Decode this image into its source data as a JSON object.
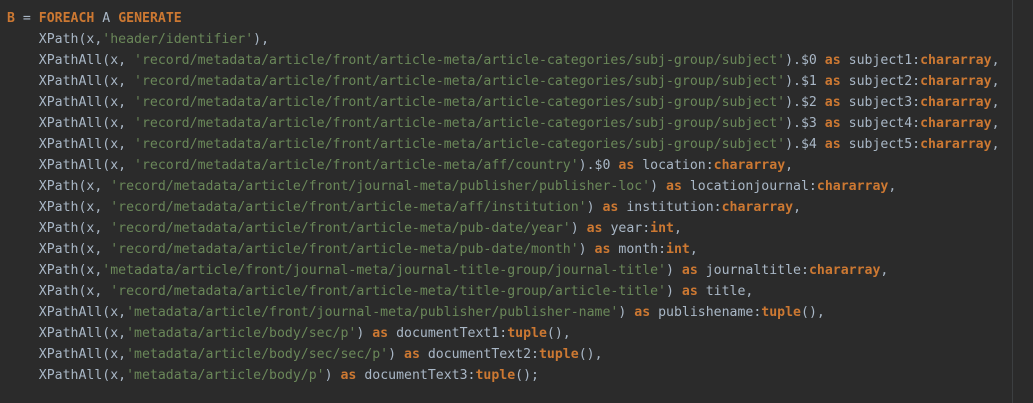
{
  "colors": {
    "background": "#2b2b2b",
    "plain": "#a9b7c6",
    "keyword": "#cc7832",
    "string": "#6a8759",
    "margin_line": "#3c3f41"
  },
  "code": {
    "lines": [
      [
        {
          "t": "kw",
          "v": "B "
        },
        {
          "t": "plain",
          "v": "= "
        },
        {
          "t": "kw",
          "v": "FOREACH"
        },
        {
          "t": "plain",
          "v": " A "
        },
        {
          "t": "kw",
          "v": "GENERATE"
        }
      ],
      [
        {
          "t": "plain",
          "v": "    XPath(x,"
        },
        {
          "t": "str",
          "v": "'header/identifier'"
        },
        {
          "t": "plain",
          "v": "),"
        }
      ],
      [
        {
          "t": "plain",
          "v": "    XPathAll(x, "
        },
        {
          "t": "str",
          "v": "'record/metadata/article/front/article-meta/article-categories/subj-group/subject'"
        },
        {
          "t": "plain",
          "v": ").$0 "
        },
        {
          "t": "kw",
          "v": "as"
        },
        {
          "t": "plain",
          "v": " subject1:"
        },
        {
          "t": "kw",
          "v": "chararray"
        },
        {
          "t": "plain",
          "v": ","
        }
      ],
      [
        {
          "t": "plain",
          "v": "    XPathAll(x, "
        },
        {
          "t": "str",
          "v": "'record/metadata/article/front/article-meta/article-categories/subj-group/subject'"
        },
        {
          "t": "plain",
          "v": ").$1 "
        },
        {
          "t": "kw",
          "v": "as"
        },
        {
          "t": "plain",
          "v": " subject2:"
        },
        {
          "t": "kw",
          "v": "chararray"
        },
        {
          "t": "plain",
          "v": ","
        }
      ],
      [
        {
          "t": "plain",
          "v": "    XPathAll(x, "
        },
        {
          "t": "str",
          "v": "'record/metadata/article/front/article-meta/article-categories/subj-group/subject'"
        },
        {
          "t": "plain",
          "v": ").$2 "
        },
        {
          "t": "kw",
          "v": "as"
        },
        {
          "t": "plain",
          "v": " subject3:"
        },
        {
          "t": "kw",
          "v": "chararray"
        },
        {
          "t": "plain",
          "v": ","
        }
      ],
      [
        {
          "t": "plain",
          "v": "    XPathAll(x, "
        },
        {
          "t": "str",
          "v": "'record/metadata/article/front/article-meta/article-categories/subj-group/subject'"
        },
        {
          "t": "plain",
          "v": ").$3 "
        },
        {
          "t": "kw",
          "v": "as"
        },
        {
          "t": "plain",
          "v": " subject4:"
        },
        {
          "t": "kw",
          "v": "chararray"
        },
        {
          "t": "plain",
          "v": ","
        }
      ],
      [
        {
          "t": "plain",
          "v": "    XPathAll(x, "
        },
        {
          "t": "str",
          "v": "'record/metadata/article/front/article-meta/article-categories/subj-group/subject'"
        },
        {
          "t": "plain",
          "v": ").$4 "
        },
        {
          "t": "kw",
          "v": "as"
        },
        {
          "t": "plain",
          "v": " subject5:"
        },
        {
          "t": "kw",
          "v": "chararray"
        },
        {
          "t": "plain",
          "v": ","
        }
      ],
      [
        {
          "t": "plain",
          "v": "    XPathAll(x, "
        },
        {
          "t": "str",
          "v": "'record/metadata/article/front/article-meta/aff/country'"
        },
        {
          "t": "plain",
          "v": ").$0 "
        },
        {
          "t": "kw",
          "v": "as"
        },
        {
          "t": "plain",
          "v": " location:"
        },
        {
          "t": "kw",
          "v": "chararray"
        },
        {
          "t": "plain",
          "v": ","
        }
      ],
      [
        {
          "t": "plain",
          "v": "    XPath(x, "
        },
        {
          "t": "str",
          "v": "'record/metadata/article/front/journal-meta/publisher/publisher-loc'"
        },
        {
          "t": "plain",
          "v": ") "
        },
        {
          "t": "kw",
          "v": "as"
        },
        {
          "t": "plain",
          "v": " locationjournal:"
        },
        {
          "t": "kw",
          "v": "chararray"
        },
        {
          "t": "plain",
          "v": ","
        }
      ],
      [
        {
          "t": "plain",
          "v": "    XPath(x, "
        },
        {
          "t": "str",
          "v": "'record/metadata/article/front/article-meta/aff/institution'"
        },
        {
          "t": "plain",
          "v": ") "
        },
        {
          "t": "kw",
          "v": "as"
        },
        {
          "t": "plain",
          "v": " institution:"
        },
        {
          "t": "kw",
          "v": "chararray"
        },
        {
          "t": "plain",
          "v": ","
        }
      ],
      [
        {
          "t": "plain",
          "v": "    XPath(x, "
        },
        {
          "t": "str",
          "v": "'record/metadata/article/front/article-meta/pub-date/year'"
        },
        {
          "t": "plain",
          "v": ") "
        },
        {
          "t": "kw",
          "v": "as"
        },
        {
          "t": "plain",
          "v": " year:"
        },
        {
          "t": "kw",
          "v": "int"
        },
        {
          "t": "plain",
          "v": ","
        }
      ],
      [
        {
          "t": "plain",
          "v": "    XPath(x, "
        },
        {
          "t": "str",
          "v": "'record/metadata/article/front/article-meta/pub-date/month'"
        },
        {
          "t": "plain",
          "v": ") "
        },
        {
          "t": "kw",
          "v": "as"
        },
        {
          "t": "plain",
          "v": " month:"
        },
        {
          "t": "kw",
          "v": "int"
        },
        {
          "t": "plain",
          "v": ","
        }
      ],
      [
        {
          "t": "plain",
          "v": "    XPath(x,"
        },
        {
          "t": "str",
          "v": "'metadata/article/front/journal-meta/journal-title-group/journal-title'"
        },
        {
          "t": "plain",
          "v": ") "
        },
        {
          "t": "kw",
          "v": "as"
        },
        {
          "t": "plain",
          "v": " journaltitle:"
        },
        {
          "t": "kw",
          "v": "chararray"
        },
        {
          "t": "plain",
          "v": ","
        }
      ],
      [
        {
          "t": "plain",
          "v": "    XPath(x, "
        },
        {
          "t": "str",
          "v": "'record/metadata/article/front/article-meta/title-group/article-title'"
        },
        {
          "t": "plain",
          "v": ") "
        },
        {
          "t": "kw",
          "v": "as"
        },
        {
          "t": "plain",
          "v": " title,"
        }
      ],
      [
        {
          "t": "plain",
          "v": "    XPathAll(x,"
        },
        {
          "t": "str",
          "v": "'metadata/article/front/journal-meta/publisher/publisher-name'"
        },
        {
          "t": "plain",
          "v": ") "
        },
        {
          "t": "kw",
          "v": "as"
        },
        {
          "t": "plain",
          "v": " publishename:"
        },
        {
          "t": "kw",
          "v": "tuple"
        },
        {
          "t": "plain",
          "v": "(),"
        }
      ],
      [
        {
          "t": "plain",
          "v": "    XPathAll(x,"
        },
        {
          "t": "str",
          "v": "'metadata/article/body/sec/p'"
        },
        {
          "t": "plain",
          "v": ") "
        },
        {
          "t": "kw",
          "v": "as"
        },
        {
          "t": "plain",
          "v": " documentText1:"
        },
        {
          "t": "kw",
          "v": "tuple"
        },
        {
          "t": "plain",
          "v": "(),"
        }
      ],
      [
        {
          "t": "plain",
          "v": "    XPathAll(x,"
        },
        {
          "t": "str",
          "v": "'metadata/article/body/sec/sec/p'"
        },
        {
          "t": "plain",
          "v": ") "
        },
        {
          "t": "kw",
          "v": "as"
        },
        {
          "t": "plain",
          "v": " documentText2:"
        },
        {
          "t": "kw",
          "v": "tuple"
        },
        {
          "t": "plain",
          "v": "(),"
        }
      ],
      [
        {
          "t": "plain",
          "v": "    XPathAll(x,"
        },
        {
          "t": "str",
          "v": "'metadata/article/body/p'"
        },
        {
          "t": "plain",
          "v": ") "
        },
        {
          "t": "kw",
          "v": "as"
        },
        {
          "t": "plain",
          "v": " documentText3:"
        },
        {
          "t": "kw",
          "v": "tuple"
        },
        {
          "t": "plain",
          "v": "();"
        }
      ]
    ]
  }
}
